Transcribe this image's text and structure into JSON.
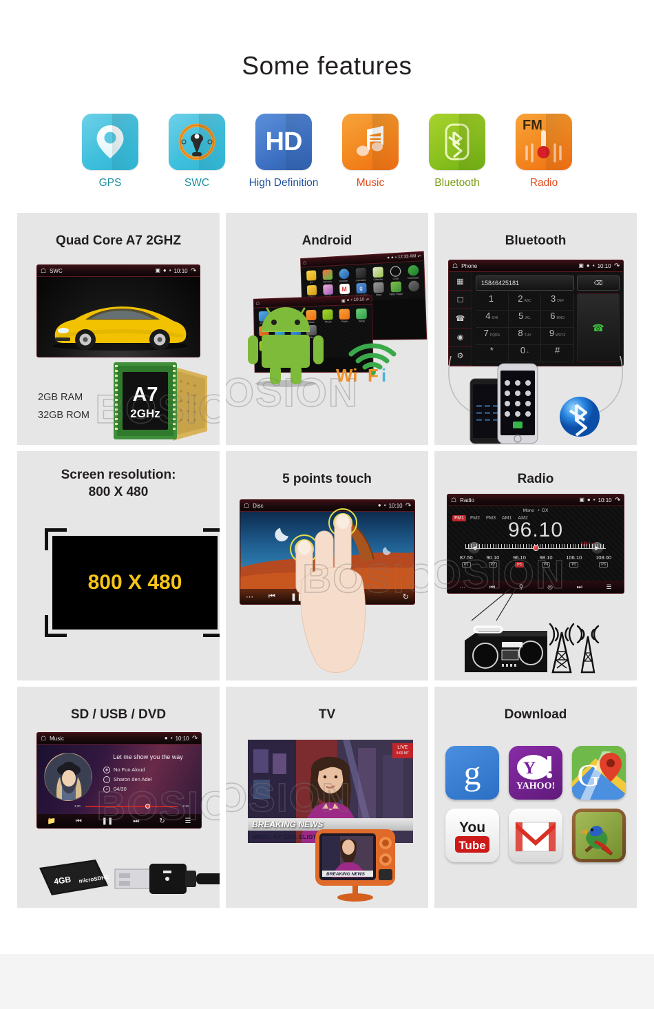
{
  "page": {
    "title": "Some features",
    "watermark_text": "BOSION"
  },
  "features": [
    {
      "id": "gps",
      "label": "GPS",
      "icon": "location-pin-icon",
      "label_color": "#1a8f9e",
      "tile": "tile-gps"
    },
    {
      "id": "swc",
      "label": "SWC",
      "icon": "steering-wheel-icon",
      "label_color": "#1a8f9e",
      "tile": "tile-swc"
    },
    {
      "id": "hd",
      "label": "High Definition",
      "icon": "hd-icon",
      "label_color": "#1f4f9e",
      "tile": "tile-hd",
      "glyph_text": "HD"
    },
    {
      "id": "music",
      "label": "Music",
      "icon": "music-note-icon",
      "label_color": "#e0491c",
      "tile": "tile-music"
    },
    {
      "id": "bt",
      "label": "Bluetooth",
      "icon": "bluetooth-icon",
      "label_color": "#7a9b12",
      "tile": "tile-bt"
    },
    {
      "id": "radio",
      "label": "Radio",
      "icon": "fm-radio-icon",
      "label_color": "#e0491c",
      "tile": "tile-radio",
      "glyph_text": "FM"
    }
  ],
  "cards": {
    "quad_core": {
      "title": "Quad Core A7 2GHZ",
      "status_bar": {
        "app": "SWC",
        "time": "10:10"
      },
      "specs": {
        "ram": "2GB RAM",
        "rom": "32GB ROM"
      },
      "chip": {
        "model": "A7",
        "speed": "2GHz"
      }
    },
    "android": {
      "title": "Android",
      "wifi_label": "WiFi",
      "front_screen": {
        "status_bar": {
          "time": "10:10"
        },
        "apps_row1": [
          "AUX IN",
          "Disc",
          "CD",
          "Music",
          "Phone",
          "Radio",
          "Setup"
        ],
        "apps_row2": [
          "TV",
          "Video",
          "DVD"
        ]
      },
      "back_screen": {
        "status_bar": {
          "time": "12:33 AM"
        },
        "apps_row1": [
          "BT",
          "Services",
          "Browser",
          "Calculator",
          "Calendar",
          "Clock",
          "Download"
        ],
        "apps_row2": [
          "Gallery",
          "Gmail",
          "Google",
          "Google Set",
          "Maps",
          "Video Player"
        ]
      }
    },
    "bluetooth": {
      "title": "Bluetooth",
      "status_bar": {
        "app": "Phone",
        "time": "10:10"
      },
      "dialed_number": "15846425181",
      "keys": [
        {
          "digit": "1",
          "sub": ""
        },
        {
          "digit": "2",
          "sub": "ABC"
        },
        {
          "digit": "3",
          "sub": "DEF"
        },
        {
          "digit": "4",
          "sub": "GHI"
        },
        {
          "digit": "5",
          "sub": "JKL"
        },
        {
          "digit": "6",
          "sub": "MNO"
        },
        {
          "digit": "7",
          "sub": "PQRS"
        },
        {
          "digit": "8",
          "sub": "TUV"
        },
        {
          "digit": "9",
          "sub": "WXYZ"
        },
        {
          "digit": "*",
          "sub": ""
        },
        {
          "digit": "0",
          "sub": "+"
        },
        {
          "digit": "#",
          "sub": ""
        }
      ],
      "sidebar_icons": [
        "keypad-icon",
        "contacts-icon",
        "call-log-icon",
        "sync-icon",
        "settings-icon"
      ]
    },
    "resolution": {
      "title_line1": "Screen resolution:",
      "title_line2": "800 X 480",
      "display_text": "800 X 480",
      "display_color": "#f5c518"
    },
    "touch": {
      "title": "5 points touch",
      "status_bar": {
        "app": "Disc",
        "time": "10:10"
      }
    },
    "radio": {
      "title": "Radio",
      "status_bar": {
        "app": "Radio",
        "time": "10:10"
      },
      "mono_label": "Mono",
      "dx_label": "DX",
      "bands": [
        "FM1",
        "FM2",
        "FM3",
        "AM1",
        "AM2"
      ],
      "active_band": "FM1",
      "frequency": "96.10",
      "unit": "MHz",
      "presets": [
        {
          "freq": "87.50",
          "slot": "P1",
          "active": false
        },
        {
          "freq": "90.10",
          "slot": "P2",
          "active": false
        },
        {
          "freq": "96.10",
          "slot": "P3",
          "active": true
        },
        {
          "freq": "98.10",
          "slot": "P4",
          "active": false
        },
        {
          "freq": "106.10",
          "slot": "P5",
          "active": false
        },
        {
          "freq": "108.00",
          "slot": "P6",
          "active": false
        }
      ]
    },
    "media": {
      "title": "SD / USB / DVD",
      "status_bar": {
        "app": "Music",
        "time": "10:10"
      },
      "song_title": "Let me show you the way",
      "album": "No Fun Aloud",
      "artist": "Sharon den Adel",
      "track": "04/30",
      "elapsed": "1:30",
      "total": "4:10",
      "sd_capacity": "4GB",
      "sd_type": "microSDHC"
    },
    "tv": {
      "title": "TV",
      "live_label": "LIVE",
      "live_time": "9:00 MT",
      "headline": "BREAKING NEWS",
      "subheadline": "WNBC: NY GOV. ELIOT SPITZER",
      "retro_caption": "BREAKING NEWS"
    },
    "download": {
      "title": "Download",
      "apps": [
        {
          "name": "Google",
          "icon": "google-icon",
          "glyph": "g"
        },
        {
          "name": "Yahoo!",
          "icon": "yahoo-icon",
          "glyph": "Y!"
        },
        {
          "name": "Google Maps",
          "icon": "google-maps-icon",
          "glyph": "G"
        },
        {
          "name": "YouTube",
          "icon": "youtube-icon",
          "glyph": "You",
          "glyph2": "Tube"
        },
        {
          "name": "Gmail",
          "icon": "gmail-icon",
          "glyph": "M"
        },
        {
          "name": "Bird App",
          "icon": "bird-app-icon",
          "glyph": ""
        }
      ]
    }
  }
}
